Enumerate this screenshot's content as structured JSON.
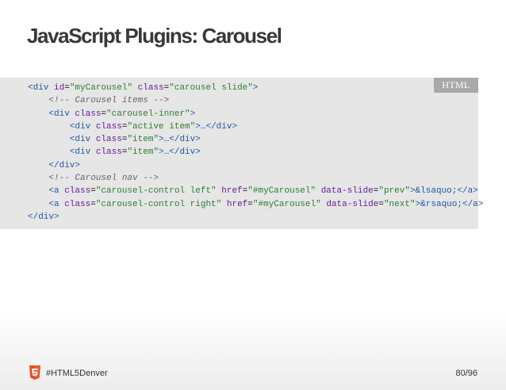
{
  "slide": {
    "title": "JavaScript Plugins: Carousel",
    "language_tag": "HTML",
    "code_lines": [
      [
        "<div",
        " id",
        "=",
        "\"myCarousel\"",
        " class",
        "=",
        "\"carousel slide\"",
        ">"
      ],
      [
        "    ",
        "<!-- Carousel items -->"
      ],
      [
        "    ",
        "<div",
        " class",
        "=",
        "\"carousel-inner\"",
        ">"
      ],
      [
        "        ",
        "<div",
        " class",
        "=",
        "\"active item\"",
        ">…</div>"
      ],
      [
        "        ",
        "<div",
        " class",
        "=",
        "\"item\"",
        ">…</div>"
      ],
      [
        "        ",
        "<div",
        " class",
        "=",
        "\"item\"",
        ">…</div>"
      ],
      [
        "    ",
        "</div>"
      ],
      [
        "    ",
        "<!-- Carousel nav -->"
      ],
      [
        "    ",
        "<a",
        " class",
        "=",
        "\"carousel-control left\"",
        " href",
        "=",
        "\"#myCarousel\"",
        " data-slide",
        "=",
        "\"prev\"",
        ">&lsaquo;</a>"
      ],
      [
        "    ",
        "<a",
        " class",
        "=",
        "\"carousel-control right\"",
        " href",
        "=",
        "\"#myCarousel\"",
        " data-slide",
        "=",
        "\"next\"",
        ">&rsaquo;</a>"
      ],
      [
        "</div>"
      ]
    ]
  },
  "footer": {
    "hashtag": "#HTML5Denver",
    "page_indicator": "80/96",
    "logo_icon": "html5-logo-icon",
    "logo_color": "#e34f26"
  }
}
